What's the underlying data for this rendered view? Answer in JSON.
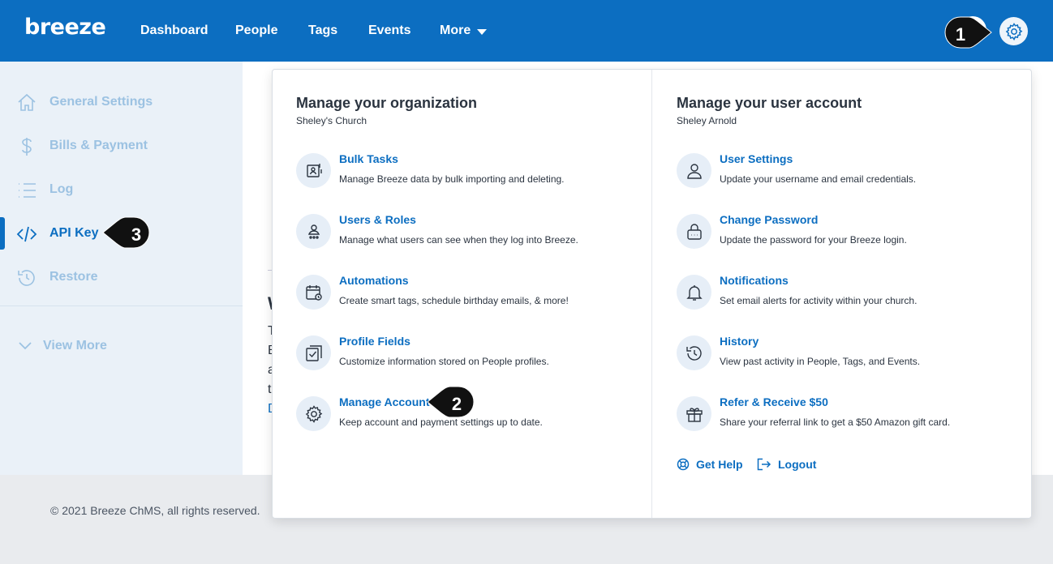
{
  "brand": {
    "logo_text": "breeze",
    "accent": "#0c6ec1"
  },
  "nav": {
    "items": [
      "Dashboard",
      "People",
      "Tags",
      "Events",
      "More"
    ],
    "settings_icon": "gear-icon"
  },
  "sidebar": {
    "items": [
      {
        "label": "General Settings",
        "icon": "home-icon"
      },
      {
        "label": "Bills & Payment",
        "icon": "dollar-icon"
      },
      {
        "label": "Log",
        "icon": "list-icon"
      },
      {
        "label": "API Key",
        "icon": "code-icon",
        "active": true
      },
      {
        "label": "Restore",
        "icon": "restore-icon"
      }
    ],
    "view_more": "View More"
  },
  "background_peek": [
    "W",
    "T",
    "B",
    "a",
    "t",
    "D"
  ],
  "footer": {
    "text": "© 2021 Breeze ChMS, all rights reserved."
  },
  "org_section": {
    "title": "Manage your organization",
    "subtitle": "Sheley's Church",
    "items": [
      {
        "title": "Bulk Tasks",
        "desc": "Manage Breeze data by bulk importing and deleting.",
        "icon": "bulk-import-icon"
      },
      {
        "title": "Users & Roles",
        "desc": "Manage what users can see when they log into Breeze.",
        "icon": "user-roles-icon"
      },
      {
        "title": "Automations",
        "desc": "Create smart tags, schedule birthday emails, & more!",
        "icon": "calendar-clock-icon"
      },
      {
        "title": "Profile Fields",
        "desc": "Customize information stored on People profiles.",
        "icon": "checkbox-icon"
      },
      {
        "title": "Manage Account",
        "desc": "Keep account and payment settings up to date.",
        "icon": "gear-icon"
      }
    ]
  },
  "user_section": {
    "title": "Manage your user account",
    "subtitle": "Sheley Arnold",
    "items": [
      {
        "title": "User Settings",
        "desc": "Update your username and email credentials.",
        "icon": "user-icon"
      },
      {
        "title": "Change Password",
        "desc": "Update the password for your Breeze login.",
        "icon": "lock-icon"
      },
      {
        "title": "Notifications",
        "desc": "Set email alerts for activity within your church.",
        "icon": "bell-icon"
      },
      {
        "title": "History",
        "desc": "View past activity in People, Tags, and Events.",
        "icon": "history-icon"
      },
      {
        "title": "Refer & Receive $50",
        "desc": "Share your referral link to get a $50 Amazon gift card.",
        "icon": "gift-icon"
      }
    ],
    "get_help": "Get Help",
    "logout": "Logout"
  },
  "callouts": [
    "1",
    "2",
    "3"
  ]
}
